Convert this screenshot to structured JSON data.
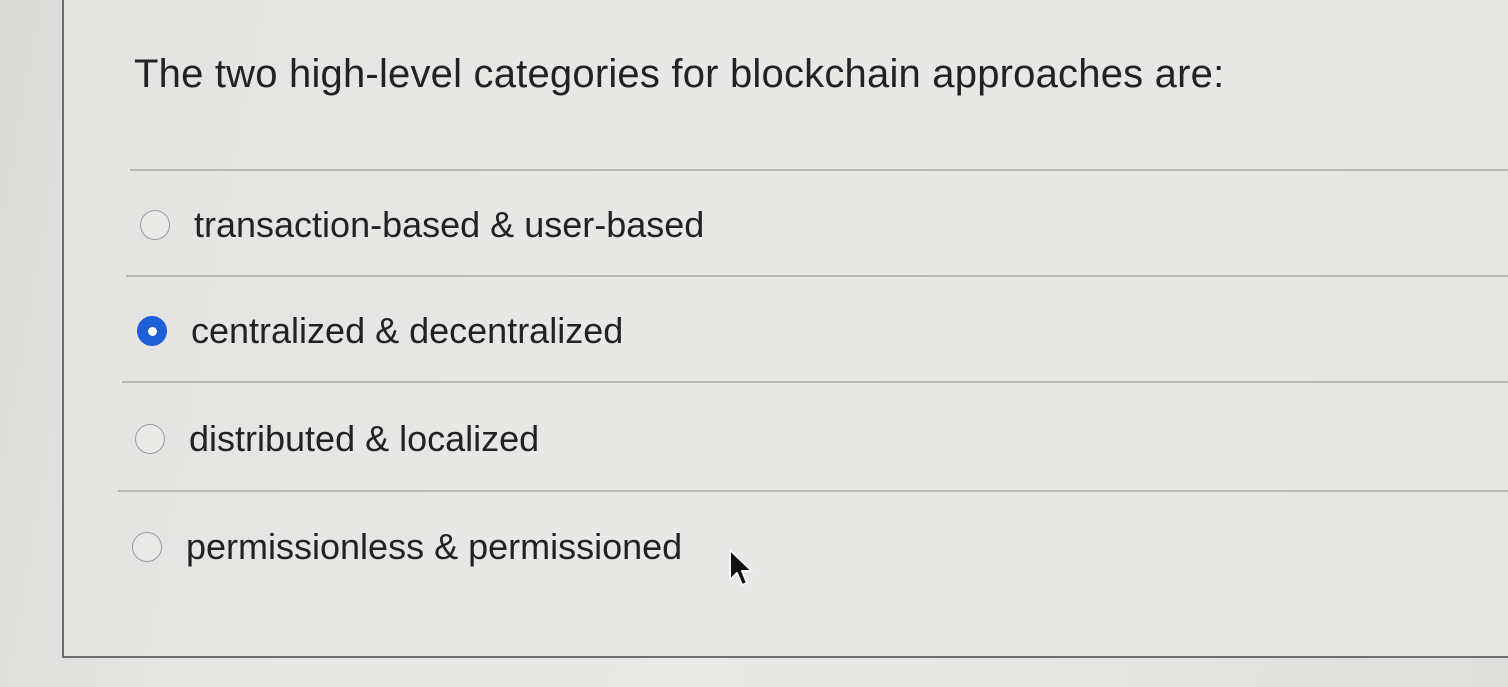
{
  "question": {
    "text": "The two high-level categories for blockchain approaches are:"
  },
  "options": [
    {
      "label": "transaction-based & user-based",
      "selected": false
    },
    {
      "label": "centralized & decentralized",
      "selected": true
    },
    {
      "label": "distributed & localized",
      "selected": false
    },
    {
      "label": "permissionless & permissioned",
      "selected": false
    }
  ],
  "colors": {
    "selected_radio": "#1c5fd6",
    "background": "#e6e6e4"
  },
  "icons": {
    "cursor": "mouse-pointer-icon"
  }
}
